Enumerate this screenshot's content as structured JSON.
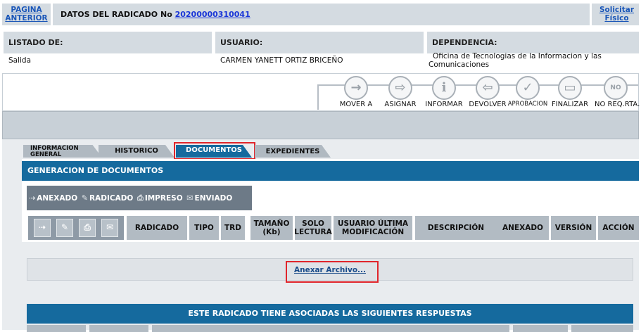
{
  "topbar": {
    "back_line1": "PAGINA",
    "back_line2": "ANTERIOR",
    "title_prefix": "DATOS DEL RADICADO No ",
    "radicado_number": "20200000310041",
    "solicitar_line1": "Solicitar",
    "solicitar_line2": "Físico"
  },
  "info": {
    "listado_label": "LISTADO DE:",
    "listado_value": "Salida",
    "usuario_label": "USUARIO:",
    "usuario_value": "CARMEN YANETT ORTIZ BRICEÑO",
    "dependencia_label": "DEPENDENCIA:",
    "dependencia_value": "Oficina de Tecnologias de la Informacion y las Comunicaciones"
  },
  "actions": [
    {
      "label": "MOVER A",
      "icon": "arrow-right-icon",
      "glyph": "→"
    },
    {
      "label": "ASIGNAR",
      "icon": "assign-icon",
      "glyph": "⇨"
    },
    {
      "label": "INFORMAR",
      "icon": "info-icon",
      "glyph": "i"
    },
    {
      "label": "DEVOLVER",
      "icon": "return-icon",
      "glyph": "⇦"
    },
    {
      "label": "APROBACION",
      "icon": "check-icon",
      "glyph": "✓"
    },
    {
      "label": "FINALIZAR",
      "icon": "document-icon",
      "glyph": "▭"
    },
    {
      "label": "NO REQ.RTA.",
      "icon": "no-icon",
      "glyph": "NO"
    }
  ],
  "tabs": {
    "info_line1": "INFORMACION",
    "info_line2": "GENERAL",
    "historico": "HISTORICO",
    "documentos": "DOCUMENTOS",
    "expedientes": "EXPEDIENTES"
  },
  "docs": {
    "header": "GENERACION DE DOCUMENTOS",
    "legend": {
      "anexado": "ANEXADO",
      "radicado": "RADICADO",
      "impreso": "IMPRESO",
      "enviado": "ENVIADO"
    },
    "columns": {
      "radicado": "RADICADO",
      "tipo": "TIPO",
      "trd": "TRD",
      "tamano_1": "TAMAÑO",
      "tamano_2": "(Kb)",
      "solo_1": "SOLO",
      "solo_2": "LECTURA",
      "usuario_1": "USUARIO ÚLTIMA",
      "usuario_2": "MODIFICACIÓN",
      "descripcion": "DESCRIPCIÓN",
      "anexado": "ANEXADO",
      "version": "VERSIÓN",
      "accion": "ACCIÓN"
    },
    "annex_link": "Anexar Archivo...",
    "responses_header": "ESTE RADICADO TIENE ASOCIADAS LAS SIGUIENTES RESPUESTAS"
  },
  "colors": {
    "blue_header": "#156a9e",
    "highlight_red": "#e0252b",
    "gray_header": "#d4dbe1"
  }
}
